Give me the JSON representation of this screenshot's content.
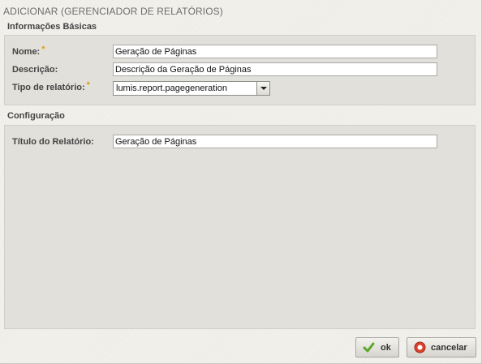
{
  "window": {
    "title": "ADICIONAR (GERENCIADOR DE RELATÓRIOS)"
  },
  "basic_section": {
    "title": "Informações Básicas",
    "fields": {
      "name": {
        "label": "Nome:",
        "required_mark": "*",
        "value": "Geração de Páginas"
      },
      "description": {
        "label": "Descrição:",
        "value": "Descrição da Geração de Páginas"
      },
      "report_type": {
        "label": "Tipo de relatório:",
        "required_mark": "*",
        "value": "lumis.report.pagegeneration"
      }
    }
  },
  "config_section": {
    "title": "Configuração",
    "fields": {
      "report_title": {
        "label": "Título do Relatório:",
        "value": "Geração de Páginas"
      }
    }
  },
  "actions": {
    "ok_label": "ok",
    "cancel_label": "cancelar"
  },
  "icons": {
    "ok": "checkmark-icon",
    "cancel": "cancel-circle-icon"
  },
  "colors": {
    "required_asterisk": "#e39a16",
    "ok_icon": "#5aa82a",
    "cancel_icon": "#d9432e"
  }
}
